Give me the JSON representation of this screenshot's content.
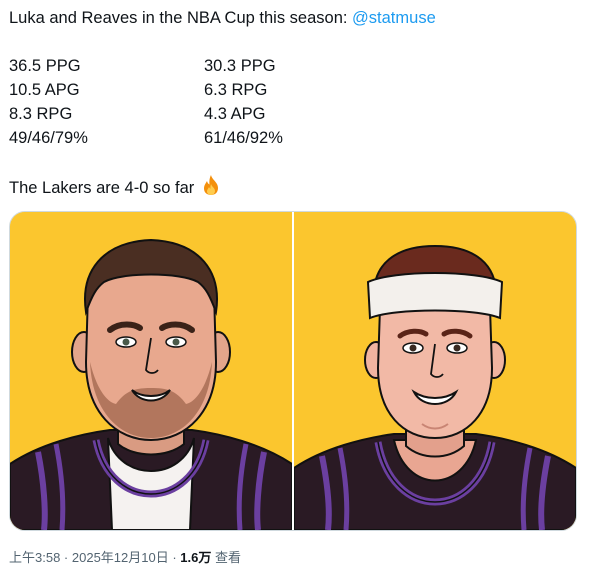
{
  "tweet": {
    "intro_text": "Luka and Reaves in the NBA Cup this season: ",
    "mention": "@statmuse",
    "stats": [
      {
        "left": "36.5 PPG",
        "right": "30.3 PPG"
      },
      {
        "left": "10.5 APG",
        "right": "6.3 RPG"
      },
      {
        "left": "8.3 RPG",
        "right": "4.3 APG"
      },
      {
        "left": "49/46/79%",
        "right": "61/46/92%"
      }
    ],
    "closing_text": "The Lakers are 4-0 so far",
    "closing_emoji": "fire-emoji-icon"
  },
  "media": {
    "background_color": "#fbc62e",
    "jersey_color": "#2a1a24",
    "trim_color": "#6b3fa0",
    "images": [
      {
        "name": "player-illustration-beard"
      },
      {
        "name": "player-illustration-headband"
      }
    ]
  },
  "meta": {
    "time": "上午3:58",
    "separator": " · ",
    "date": "2025年12月10日",
    "views_count": "1.6万",
    "views_label": " 查看"
  },
  "colors": {
    "link": "#1d9bf0",
    "text": "#0f1419",
    "secondary": "#536471",
    "border": "#cfd9de"
  }
}
